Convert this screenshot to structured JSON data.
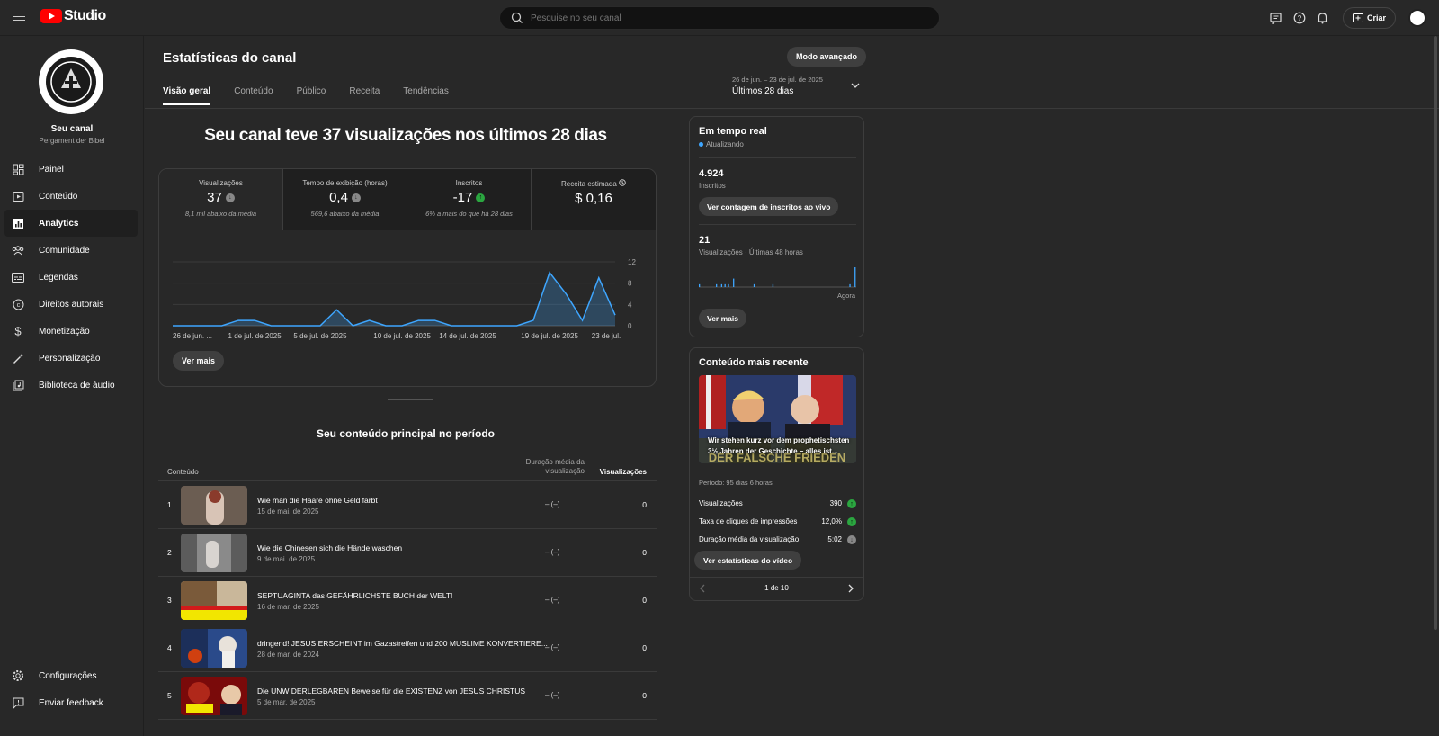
{
  "app": {
    "logo_text": "Studio"
  },
  "search": {
    "placeholder": "Pesquise no seu canal"
  },
  "header": {
    "create_label": "Criar"
  },
  "sidebar": {
    "channel_name": "Seu canal",
    "channel_sub": "Pergament der Bibel",
    "items": [
      {
        "label": "Painel",
        "icon": "dashboard-icon"
      },
      {
        "label": "Conteúdo",
        "icon": "content-icon"
      },
      {
        "label": "Analytics",
        "icon": "analytics-icon",
        "active": true
      },
      {
        "label": "Comunidade",
        "icon": "community-icon"
      },
      {
        "label": "Legendas",
        "icon": "subtitles-icon"
      },
      {
        "label": "Direitos autorais",
        "icon": "copyright-icon"
      },
      {
        "label": "Monetização",
        "icon": "dollar-icon"
      },
      {
        "label": "Personalização",
        "icon": "magic-wand-icon"
      },
      {
        "label": "Biblioteca de áudio",
        "icon": "audio-library-icon"
      }
    ],
    "bottom": [
      {
        "label": "Configurações",
        "icon": "gear-icon"
      },
      {
        "label": "Enviar feedback",
        "icon": "feedback-icon"
      }
    ]
  },
  "page": {
    "title": "Estatísticas do canal",
    "advanced_label": "Modo avançado",
    "tabs": [
      {
        "label": "Visão geral",
        "active": true
      },
      {
        "label": "Conteúdo"
      },
      {
        "label": "Público"
      },
      {
        "label": "Receita"
      },
      {
        "label": "Tendências"
      }
    ],
    "date_range": "26 de jun. – 23 de jul. de 2025",
    "date_label": "Últimos 28 dias"
  },
  "overview": {
    "headline": "Seu canal teve 37 visualizações nos últimos 28 dias",
    "metrics": [
      {
        "label": "Visualizações",
        "value": "37",
        "badge": "gray",
        "sub": "8,1 mil abaixo da média"
      },
      {
        "label": "Tempo de exibição (horas)",
        "value": "0,4",
        "badge": "gray",
        "sub": "569,6 abaixo da média"
      },
      {
        "label": "Inscritos",
        "value": "-17",
        "badge": "green",
        "sub": "6% a mais do que há 28 dias"
      },
      {
        "label": "Receita estimada",
        "value": "$ 0,16",
        "badge": "",
        "sub": ""
      }
    ],
    "see_more": "Ver mais"
  },
  "chart_data": {
    "type": "area",
    "x": [
      "26 de jun.",
      "27",
      "28",
      "29",
      "30",
      "1 de jul. de 2025",
      "2",
      "3",
      "4",
      "5 de jul. de 2025",
      "6",
      "7",
      "8",
      "9",
      "10 de jul. de 2025",
      "11",
      "12",
      "13",
      "14 de jul. de 2025",
      "15",
      "16",
      "17",
      "18",
      "19 de jul. de 2025",
      "20",
      "21",
      "22",
      "23 de jul."
    ],
    "series": [
      {
        "values": [
          0,
          0,
          0,
          0,
          1,
          1,
          0,
          0,
          0,
          0,
          3,
          0,
          1,
          0,
          0,
          1,
          1,
          0,
          0,
          0,
          0,
          0,
          1,
          10,
          6,
          1,
          9,
          2
        ]
      }
    ],
    "tick_labels": [
      "26 de jun. ...",
      "1 de jul. de 2025",
      "5 de jul. de 2025",
      "10 de jul. de 2025",
      "14 de jul. de 2025",
      "19 de jul. de 2025",
      "23 de jul."
    ],
    "tick_index": [
      0,
      5,
      9,
      14,
      18,
      23,
      27
    ],
    "yticks": [
      0,
      4,
      8,
      12
    ],
    "ylim": [
      0,
      12
    ],
    "color": "#3ea6ff"
  },
  "top_content": {
    "title": "Seu conteúdo principal no período",
    "col_content": "Conteúdo",
    "col_duration": "Duração média da visualização",
    "col_views": "Visualizações",
    "rows": [
      {
        "rank": "1",
        "title": "Wie man die Haare ohne Geld färbt",
        "date": "15 de mai. de 2025",
        "duration": "–  (–)",
        "views": "0"
      },
      {
        "rank": "2",
        "title": "Wie die Chinesen sich die Hände waschen",
        "date": "9 de mai. de 2025",
        "duration": "–  (–)",
        "views": "0"
      },
      {
        "rank": "3",
        "title": "SEPTUAGINTA das GEFÄHRLICHSTE BUCH der WELT!",
        "date": "16 de mar. de 2025",
        "duration": "–  (–)",
        "views": "0"
      },
      {
        "rank": "4",
        "title": "dringend! JESUS ERSCHEINT im Gazastreifen und 200 MUSLIME KONVERTIERE...",
        "date": "28 de mar. de 2024",
        "duration": "–  (–)",
        "views": "0"
      },
      {
        "rank": "5",
        "title": "Die UNWIDERLEGBAREN Beweise für die EXISTENZ von JESUS CHRISTUS",
        "date": "5 de mar. de 2025",
        "duration": "–  (–)",
        "views": "0"
      }
    ]
  },
  "realtime": {
    "title": "Em tempo real",
    "updating": "Atualizando",
    "subs_value": "4.924",
    "subs_label": "Inscritos",
    "live_btn": "Ver contagem de inscritos ao vivo",
    "views_value": "21",
    "views_label": "Visualizações · Últimas 48 horas",
    "now_label": "Agora",
    "see_more": "Ver mais",
    "bars": [
      1,
      0,
      0,
      0,
      0,
      0,
      0,
      0,
      0,
      0,
      1,
      0,
      0,
      1,
      0,
      1,
      0,
      1,
      0,
      0,
      3,
      0,
      0,
      0,
      0,
      0,
      0,
      0,
      0,
      0,
      0,
      0,
      1,
      0,
      0,
      0,
      0,
      0,
      0,
      0,
      0,
      0,
      0,
      1,
      0,
      0,
      0,
      0,
      0,
      0,
      0,
      0,
      0,
      0,
      0,
      0,
      0,
      0,
      0,
      0,
      0,
      0,
      0,
      0,
      0,
      0,
      0,
      0,
      0,
      0,
      0,
      0,
      0,
      0,
      0,
      0,
      0,
      0,
      0,
      0,
      0,
      0,
      0,
      0,
      0,
      0,
      0,
      0,
      1,
      0,
      0,
      7
    ]
  },
  "recent": {
    "title": "Conteúdo mais recente",
    "video_caption": "Wir stehen kurz vor dem prophetischsten 3½ Jahren der Geschichte – alles ist...",
    "thumb_text": "DER FALSCHE FRIEDEN",
    "period": "Período: 95 dias 6 horas",
    "stats": [
      {
        "label": "Visualizações",
        "value": "390",
        "badge": "green"
      },
      {
        "label": "Taxa de cliques de impressões",
        "value": "12,0%",
        "badge": "green"
      },
      {
        "label": "Duração média da visualização",
        "value": "5:02",
        "badge": "gray"
      }
    ],
    "video_btn": "Ver estatísticas do vídeo",
    "pager": "1 de 10"
  }
}
